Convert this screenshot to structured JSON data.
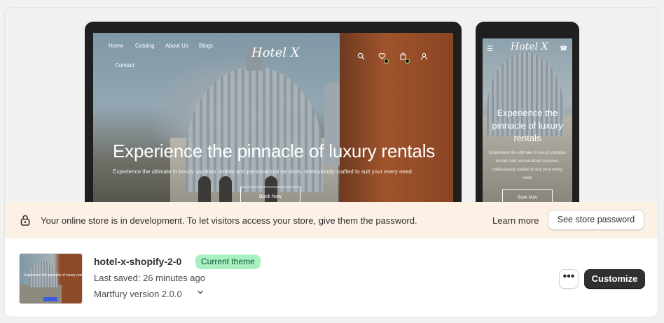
{
  "desktop_preview": {
    "nav_items": [
      "Home",
      "Catalog",
      "About Us",
      "Blogs",
      "Contact"
    ],
    "logo": "Hotel X",
    "hero_title": "Experience the pinnacle of luxury rentals",
    "hero_subtitle": "Experience the ultimate in luxury vacation rentals and personalized services, meticulously crafted to suit your every need.",
    "book_now": "Book Now",
    "icons": [
      "search-icon",
      "wishlist-icon",
      "cart-icon",
      "account-icon"
    ],
    "wishlist_count": "0",
    "cart_count": "0"
  },
  "mobile_preview": {
    "logo": "Hotel X",
    "hero_title": "Experience the pinnacle of luxury rentals",
    "hero_subtitle": "Experience the ultimate in luxury vacation rentals and personalized services, meticulously crafted to suit your every need.",
    "book_now": "Book Now",
    "icons": [
      "menu-icon",
      "phone-icon"
    ]
  },
  "banner": {
    "message": "Your online store is in development. To let visitors access your store, give them the password.",
    "learn_more": "Learn more",
    "see_password": "See store password",
    "background": "#fdf0e4"
  },
  "theme": {
    "name": "hotel-x-shopify-2-0",
    "badge": "Current theme",
    "last_saved": "Last saved: 26 minutes ago",
    "version": "Martfury version 2.0.0",
    "more_label": "•••",
    "customize_label": "Customize",
    "badge_color": "#a8f0c0",
    "customize_color": "#303030"
  }
}
